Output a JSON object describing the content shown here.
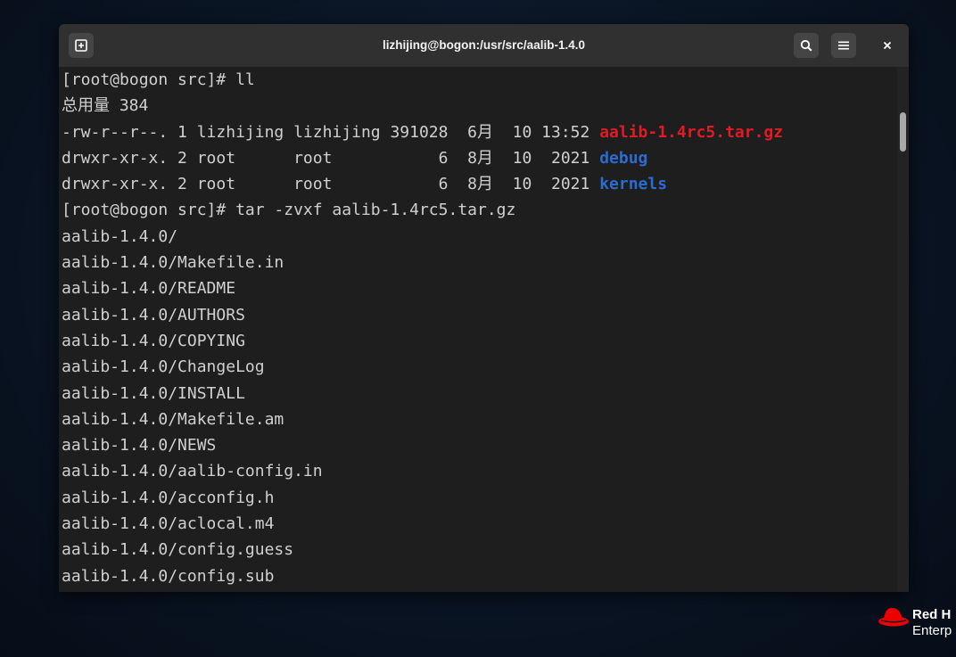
{
  "window": {
    "title": "lizhijing@bogon:/usr/src/aalib-1.4.0"
  },
  "toolbar": {
    "new_tab_icon": "new-tab-icon",
    "search_icon": "search-icon",
    "menu_icon": "hamburger-menu-icon",
    "close_label": "×"
  },
  "terminal": {
    "lines": [
      {
        "text": "[root@bogon src]# ll"
      },
      {
        "text": "总用量 384"
      },
      {
        "text": "-rw-r--r--. 1 lizhijing lizhijing 391028  6月  10 13:52 ",
        "highlight": "aalib-1.4rc5.tar.gz",
        "color": "#e01b24"
      },
      {
        "text": "drwxr-xr-x. 2 root      root           6  8月  10  2021 ",
        "highlight": "debug",
        "color": "#2a6ccf"
      },
      {
        "text": "drwxr-xr-x. 2 root      root           6  8月  10  2021 ",
        "highlight": "kernels",
        "color": "#2a6ccf"
      },
      {
        "text": "[root@bogon src]# tar -zvxf aalib-1.4rc5.tar.gz"
      },
      {
        "text": "aalib-1.4.0/"
      },
      {
        "text": "aalib-1.4.0/Makefile.in"
      },
      {
        "text": "aalib-1.4.0/README"
      },
      {
        "text": "aalib-1.4.0/AUTHORS"
      },
      {
        "text": "aalib-1.4.0/COPYING"
      },
      {
        "text": "aalib-1.4.0/ChangeLog"
      },
      {
        "text": "aalib-1.4.0/INSTALL"
      },
      {
        "text": "aalib-1.4.0/Makefile.am"
      },
      {
        "text": "aalib-1.4.0/NEWS"
      },
      {
        "text": "aalib-1.4.0/aalib-config.in"
      },
      {
        "text": "aalib-1.4.0/acconfig.h"
      },
      {
        "text": "aalib-1.4.0/aclocal.m4"
      },
      {
        "text": "aalib-1.4.0/config.guess"
      },
      {
        "text": "aalib-1.4.0/config.sub"
      }
    ]
  },
  "brand": {
    "line1": "Red H",
    "line2": "Enterp",
    "logo_icon": "red-hat-logo-icon",
    "accent": "#ee0000"
  },
  "colors": {
    "background": "#0b1524",
    "terminal_bg": "#1e1e1e",
    "titlebar_bg": "#303030",
    "text": "#d0d0d0"
  }
}
